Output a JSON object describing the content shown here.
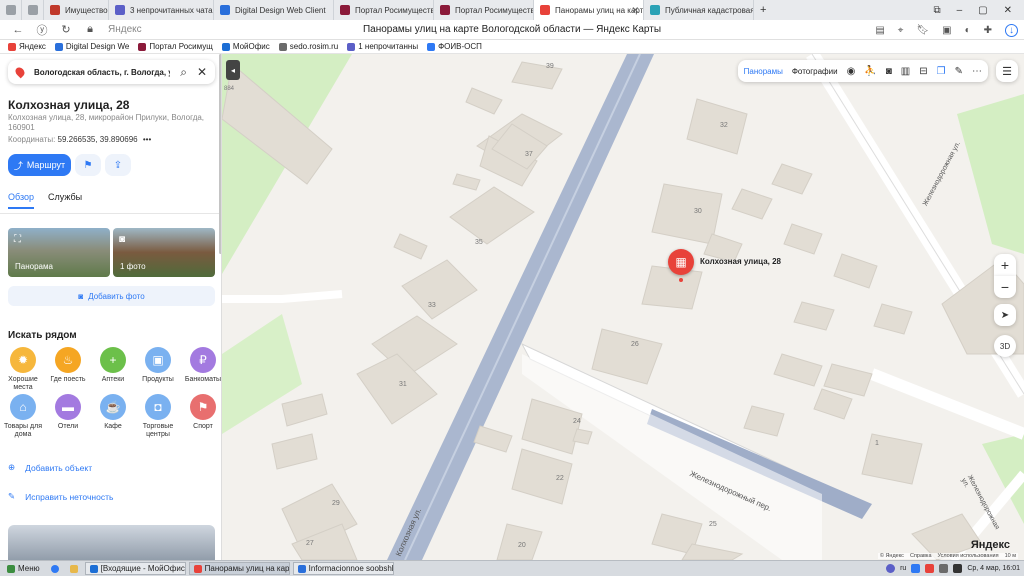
{
  "browser": {
    "tabs": [
      {
        "label": "",
        "color": "#9aa0a6"
      },
      {
        "label": "",
        "color": "#9aa0a6"
      },
      {
        "label": "Имущество",
        "color": "#c0392b"
      },
      {
        "label": "3 непрочитанных чата",
        "color": "#5b5fc7"
      },
      {
        "label": "Digital Design Web Client",
        "color": "#2a6fdb"
      },
      {
        "label": "Портал Росимущества",
        "color": "#8b1a3a"
      },
      {
        "label": "Портал Росимущества",
        "color": "#8b1a3a"
      },
      {
        "label": "Панорамы улиц на карт",
        "color": "#e8423a",
        "active": true
      },
      {
        "label": "Публичная кадастровая",
        "color": "#2aa1b5"
      }
    ],
    "new_tab": "+",
    "address_domain": "Яндекс",
    "page_title": "Панорамы улиц на карте Вологодской области — Яндекс Карты",
    "bookmarks": [
      {
        "label": "Яндекс",
        "color": "#e8423a"
      },
      {
        "label": "Digital Design We",
        "color": "#2a6fdb"
      },
      {
        "label": "Портал Росимущ",
        "color": "#8b1a3a"
      },
      {
        "label": "МойОфис",
        "color": "#1c6ed5"
      },
      {
        "label": "sedo.rosim.ru",
        "color": "#6b6b6b"
      },
      {
        "label": "1 непрочитанны",
        "color": "#5b5fc7"
      },
      {
        "label": "ФОИВ-ОСП",
        "color": "#2e79f4"
      }
    ]
  },
  "sidebar": {
    "search_value": "Вологодская область, г. Вологда, ул.",
    "address_title": "Колхозная улица, 28",
    "address_sub": "Колхозная улица, 28, микрорайон Прилуки, Вологда, 160901",
    "coords_label": "Координаты:",
    "coords_value": "59.266535, 39.890696",
    "coords_more": "•••",
    "route_label": "Маршрут",
    "tabs": [
      "Обзор",
      "Службы"
    ],
    "photos": [
      {
        "label": "Панорама"
      },
      {
        "label": "1 фото"
      }
    ],
    "add_photo": "Добавить фото",
    "nearby_title": "Искать рядом",
    "categories": [
      {
        "label": "Хорошие места",
        "color": "#f6b73c",
        "glyph": "✹"
      },
      {
        "label": "Где поесть",
        "color": "#f5a623",
        "glyph": "♨"
      },
      {
        "label": "Аптеки",
        "color": "#6cc04a",
        "glyph": "+"
      },
      {
        "label": "Продукты",
        "color": "#7ab1f0",
        "glyph": "▣"
      },
      {
        "label": "Банкоматы",
        "color": "#a37ae0",
        "glyph": "₽"
      },
      {
        "label": "Товары для дома",
        "color": "#7ab1f0",
        "glyph": "⌂"
      },
      {
        "label": "Отели",
        "color": "#a37ae0",
        "glyph": "▬"
      },
      {
        "label": "Кафе",
        "color": "#7ab1f0",
        "glyph": "☕"
      },
      {
        "label": "Торговые центры",
        "color": "#7ab1f0",
        "glyph": "◘"
      },
      {
        "label": "Спорт",
        "color": "#e86f6f",
        "glyph": "⚑"
      }
    ],
    "add_object": "Добавить объект",
    "fix_error": "Исправить неточность"
  },
  "map": {
    "toolbar": {
      "panoramas": "Панорамы",
      "photos": "Фотографии"
    },
    "marker_label": "Колхозная улица, 28",
    "btn_3d": "3D",
    "building_numbers": [
      "39",
      "37",
      "35",
      "33",
      "31",
      "32",
      "30",
      "26",
      "24",
      "22",
      "29",
      "27",
      "25",
      "20",
      "1",
      "884"
    ],
    "street_labels": [
      "Железнодорожный пер.",
      "Колхозная ул.",
      "Железнодорожная ул."
    ],
    "logo": "Яндекс",
    "copyright": [
      "© Яндекс",
      "Справка",
      "Условия использования",
      "10 м"
    ]
  },
  "taskbar": {
    "start": "Меню",
    "items": [
      {
        "label": "[Входящие - МойОфис П...",
        "color": "#1c6ed5"
      },
      {
        "label": "Панорамы улиц на карте...",
        "color": "#e8423a",
        "active": true
      },
      {
        "label": "Informacionnoe soobshhe...",
        "color": "#2a6fdb"
      }
    ],
    "lang": "ru",
    "clock": "Ср, 4 мар, 16:01"
  }
}
